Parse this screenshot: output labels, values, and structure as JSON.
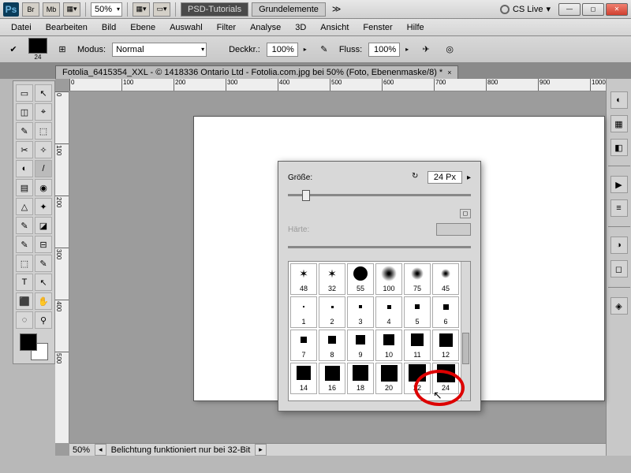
{
  "titlebar": {
    "zoom": "50%",
    "tab1": "PSD-Tutorials",
    "tab2": "Grundelemente",
    "cslive": "CS Live"
  },
  "menu": [
    "Datei",
    "Bearbeiten",
    "Bild",
    "Ebene",
    "Auswahl",
    "Filter",
    "Analyse",
    "3D",
    "Ansicht",
    "Fenster",
    "Hilfe"
  ],
  "options": {
    "size_label": "24",
    "modus_label": "Modus:",
    "modus_value": "Normal",
    "deckkr_label": "Deckkr.:",
    "deckkr_value": "100%",
    "fluss_label": "Fluss:",
    "fluss_value": "100%"
  },
  "doc": {
    "title": "Fotolia_6415354_XXL - © 1418336 Ontario Ltd - Fotolia.com.jpg bei 50% (Foto, Ebenenmaske/8) *"
  },
  "ruler_h": [
    "0",
    "100",
    "200",
    "300",
    "400",
    "500",
    "600",
    "700",
    "800",
    "900",
    "1000"
  ],
  "ruler_v": [
    "0",
    "100",
    "200",
    "300",
    "400",
    "500"
  ],
  "brush_panel": {
    "size_label": "Größe:",
    "size_value": "24 Px",
    "hardness_label": "Härte:",
    "brushes": [
      {
        "n": "48",
        "t": "scatter"
      },
      {
        "n": "32",
        "t": "scatter"
      },
      {
        "n": "55",
        "t": "dot",
        "s": 18
      },
      {
        "n": "100",
        "t": "soft",
        "s": 20
      },
      {
        "n": "75",
        "t": "soft",
        "s": 16
      },
      {
        "n": "45",
        "t": "soft",
        "s": 12
      },
      {
        "n": "1",
        "t": "sq",
        "s": 2
      },
      {
        "n": "2",
        "t": "sq",
        "s": 3
      },
      {
        "n": "3",
        "t": "sq",
        "s": 4
      },
      {
        "n": "4",
        "t": "sq",
        "s": 5
      },
      {
        "n": "5",
        "t": "sq",
        "s": 6
      },
      {
        "n": "6",
        "t": "sq",
        "s": 7
      },
      {
        "n": "7",
        "t": "sq",
        "s": 8
      },
      {
        "n": "8",
        "t": "sq",
        "s": 10
      },
      {
        "n": "9",
        "t": "sq",
        "s": 12
      },
      {
        "n": "10",
        "t": "sq",
        "s": 14
      },
      {
        "n": "11",
        "t": "sq",
        "s": 16
      },
      {
        "n": "12",
        "t": "sq",
        "s": 17
      },
      {
        "n": "14",
        "t": "sq",
        "s": 18
      },
      {
        "n": "16",
        "t": "sq",
        "s": 19
      },
      {
        "n": "18",
        "t": "sq",
        "s": 20
      },
      {
        "n": "20",
        "t": "sq",
        "s": 21
      },
      {
        "n": "22",
        "t": "sq",
        "s": 22
      },
      {
        "n": "24",
        "t": "sq",
        "s": 23
      }
    ]
  },
  "status": {
    "zoom": "50%",
    "msg": "Belichtung funktioniert nur bei 32-Bit"
  },
  "tools": [
    "▭",
    "↖",
    "◫",
    "⌖",
    "✎",
    "⬚",
    "✂",
    "✧",
    "◐",
    "/",
    "▤",
    "◉",
    "△",
    "✦",
    "✎",
    "◪",
    "✎",
    "⊟",
    "⬚",
    "✎",
    "T",
    "↖",
    "⬛",
    "✋",
    "◌",
    "⚲"
  ]
}
